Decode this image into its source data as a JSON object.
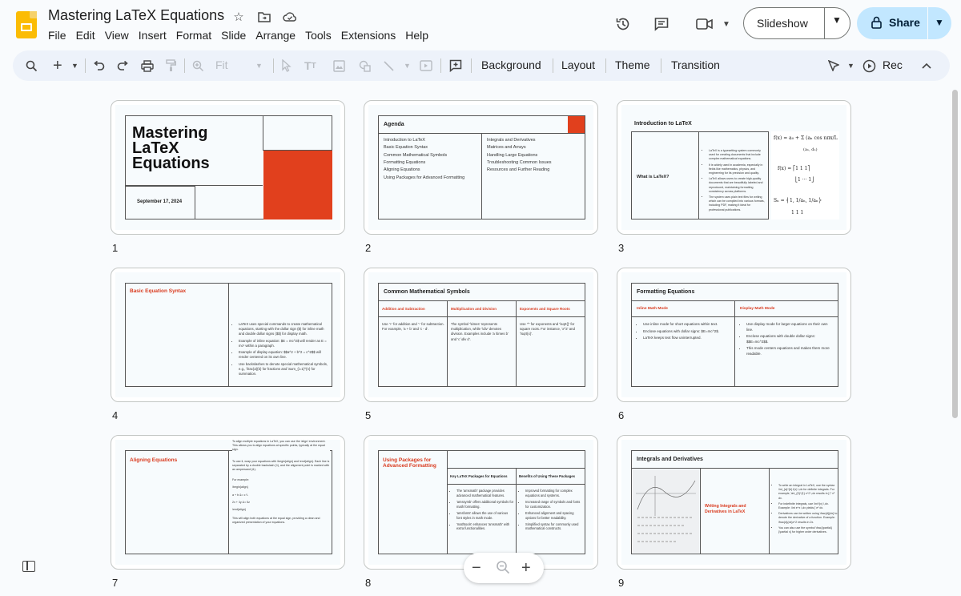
{
  "app": {
    "title": "Mastering LaTeX Equations",
    "menu": [
      "File",
      "Edit",
      "View",
      "Insert",
      "Format",
      "Slide",
      "Arrange",
      "Tools",
      "Extensions",
      "Help"
    ],
    "slideshow_label": "Slideshow",
    "share_label": "Share",
    "accent": "#c2e7ff"
  },
  "toolbar": {
    "zoom_label": "Fit",
    "background_label": "Background",
    "layout_label": "Layout",
    "theme_label": "Theme",
    "transition_label": "Transition",
    "rec_label": "Rec"
  },
  "slides": {
    "s1": {
      "num": "1",
      "title": "Mastering LaTeX Equations",
      "line1": "Mastering",
      "line2": "LaTeX",
      "line3": "Equations",
      "date": "September 17, 2024"
    },
    "s2": {
      "num": "2",
      "title": "Agenda",
      "left": [
        "Introduction to LaTeX",
        "Basic Equation Syntax",
        "Common Mathematical Symbols",
        "Formatting Equations",
        "Aligning Equations",
        "Using Packages for Advanced Formatting"
      ],
      "right": [
        "Integrals and Derivatives",
        "Matrices and Arrays",
        "Handling Large Equations",
        "Troubleshooting Common Issues",
        "Resources and Further Reading"
      ]
    },
    "s3": {
      "num": "3",
      "title": "Introduction to LaTeX",
      "subtitle": "What is LaTeX?",
      "bullets": [
        "LaTeX is a typesetting system commonly used for creating documents that include complex mathematical equations.",
        "It is widely used in academia, especially in fields like mathematics, physics, and engineering for its precision and quality.",
        "LaTeX allows users to create high-quality documents that are beautifully labeled and reproduced, maintaining formatting consistency across platforms.",
        "The system uses plain text files for writing which can be compiled into various formats, including PDF, making it ideal for professional publications."
      ]
    },
    "s4": {
      "num": "4",
      "title": "Basic Equation Syntax",
      "bullets": [
        "LaTeX uses special commands to create mathematical equations, starting with the dollar sign ($) for inline math and double dollar signs ($$) for display math.",
        "Example of inline equation: $E = mc^2$ will render as E = mc² within a paragraph.",
        "Example of display equation: $$a^2 + b^2 = c^2$$ will render centered on its own line.",
        "Use backslashes to denote special mathematical symbols, e.g., \\frac{a}{b} for fractions and \\sum_{i=1}^{n} for summation."
      ]
    },
    "s5": {
      "num": "5",
      "title": "Common Mathematical Symbols",
      "cols": [
        {
          "head": "Addition and Subtraction",
          "body": "Use '+' for addition and '-' for subtraction. For example, 'a + b' and 'c - d'."
        },
        {
          "head": "Multiplication and Division",
          "body": "The symbol '\\times' represents multiplication, while '\\div' denotes division. Examples include 'a \\times b' and 'c \\div d'."
        },
        {
          "head": "Exponents and Square Roots",
          "body": "Use '^' for exponents and '\\sqrt{}' for square roots. For instance, 'x^2' and '\\sqrt{x}'."
        }
      ]
    },
    "s6": {
      "num": "6",
      "title": "Formatting Equations",
      "left_head": "Inline Math Mode",
      "left": [
        "Use inline mode for short equations within text.",
        "Enclose equations with dollar signs: $E=mc^2$.",
        "LaTeX keeps text flow uninterrupted."
      ],
      "right_head": "Display Math Mode",
      "right": [
        "Use display mode for larger equations on their own line.",
        "Enclose equations with double dollar signs: $$E=mc^2$$.",
        "This mode centers equations and makes them more readable."
      ]
    },
    "s7": {
      "num": "7",
      "title": "Aligning Equations",
      "p1": "To align multiple equations in LaTeX, you can use the 'align' environment. This allows you to align equations at specific points, typically at the equal sign.",
      "p2": "To use it, wrap your equations with \\begin{align} and \\end{align}. Each line is separated by a double backslash (\\\\), and the alignment point is marked with an ampersand (&).",
      "p3": "For example:",
      "p4": "\\begin{align}",
      "p5": "a + b &= c \\\\",
      "p6": "2x + 3y &= 5z",
      "p7": "\\end{align}",
      "p8": "This will align both equations at the equal sign, providing a clean and organized presentation of your equations."
    },
    "s8": {
      "num": "8",
      "title": "Using Packages for Advanced Formatting",
      "left_head": "Key LaTeX Packages for Equations",
      "left": [
        "The 'amsmath' package provides advanced mathematical features.",
        "'amssymb' offers additional symbols for math formatting.",
        "'amsfonts' allows the use of various font styles in math mode.",
        "'mathtools' enhances 'amsmath' with extra functionalities."
      ],
      "right_head": "Benefits of Using These Packages",
      "right": [
        "Improved formatting for complex equations and systems.",
        "Increased range of symbols and fonts for customization.",
        "Enhanced alignment and spacing options for better readability.",
        "Simplified syntax for commonly used mathematical constructs."
      ]
    },
    "s9": {
      "num": "9",
      "title": "Integrals and Derivatives",
      "subtitle": "Writing Integrals and Derivatives in LaTeX",
      "bullets": [
        "To write an integral in LaTeX, use the syntax \\int_{a}^{b} f(x) \\,dx for definite integrals. For example, \\int_{0}^{1} x^2 \\,dx results in ∫₀¹ x² dx.",
        "For indefinite integrals, use \\int f(x) \\,dx. Example: \\int e^x \\,dx yields ∫ eˣ dx.",
        "Derivatives can be written using \\frac{d}{dx} to denote the derivative of a function. Example: \\frac{d}{dx}x^2 results in 2x.",
        "You can also use the symbol \\frac{\\partial}{\\partial x} for higher order derivatives."
      ]
    }
  },
  "zoom": {
    "minus": "−",
    "plus": "+"
  }
}
